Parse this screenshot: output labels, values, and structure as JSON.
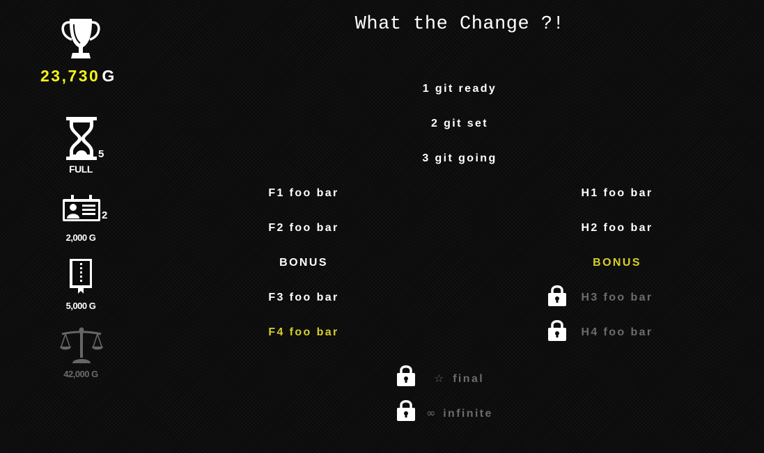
{
  "title": "What the Change ?!",
  "sidebar": {
    "gold": {
      "amount": "23,730",
      "unit": "G",
      "icon": "trophy-icon"
    },
    "items": [
      {
        "icon": "hourglass-icon",
        "count": "5",
        "label": "FULL",
        "state": "owned"
      },
      {
        "icon": "id-card-icon",
        "count": "2",
        "label": "2,000 G",
        "state": "owned"
      },
      {
        "icon": "book-icon",
        "count": "",
        "label": "5,000 G",
        "state": "available"
      },
      {
        "icon": "scales-icon",
        "count": "",
        "label": "42,000 G",
        "state": "unaffordable"
      }
    ]
  },
  "levels": {
    "center": [
      "1 git ready",
      "2 git set",
      "3 git going"
    ],
    "left": [
      {
        "label": "F1 foo bar",
        "state": "open"
      },
      {
        "label": "F2 foo bar",
        "state": "open"
      },
      {
        "label": "BONUS",
        "state": "open"
      },
      {
        "label": "F3 foo bar",
        "state": "open"
      },
      {
        "label": "F4 foo bar",
        "state": "highlighted"
      }
    ],
    "right": [
      {
        "label": "H1 foo bar",
        "state": "open"
      },
      {
        "label": "H2 foo bar",
        "state": "open"
      },
      {
        "label": "BONUS",
        "state": "highlighted"
      },
      {
        "label": "H3 foo bar",
        "state": "locked"
      },
      {
        "label": "H4 foo bar",
        "state": "locked"
      }
    ],
    "final": {
      "symbol": "☆",
      "label": "final",
      "state": "locked"
    },
    "infinite": {
      "symbol": "∞",
      "label": "infinite",
      "state": "locked"
    }
  },
  "colors": {
    "gold": "#f4f21c",
    "highlight": "#d6d02a",
    "locked": "#6c6c6c",
    "text": "#ffffff"
  }
}
